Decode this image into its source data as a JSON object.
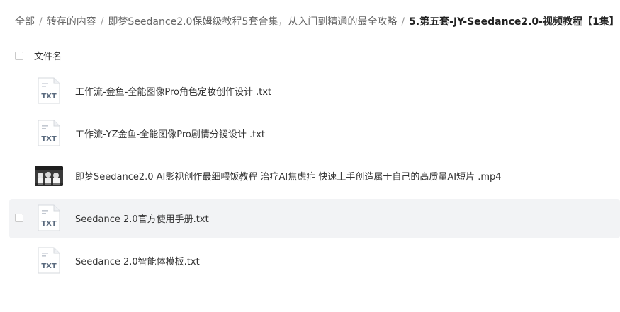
{
  "breadcrumb": {
    "items": [
      {
        "label": "全部"
      },
      {
        "label": "转存的内容"
      },
      {
        "label": "即梦Seedance2.0保姆级教程5套合集，从入门到精通的最全攻略"
      },
      {
        "label": "5.第五套-JY-Seedance2.0-视频教程【1集】"
      }
    ],
    "separator": "/"
  },
  "file_list": {
    "header_label": "文件名",
    "files": [
      {
        "name": "工作流-金鱼-全能图像Pro角色定妆创作设计 .txt",
        "type_badge": "TXT",
        "icon": "txt-file-icon"
      },
      {
        "name": "工作流-YZ金鱼-全能图像Pro剧情分镜设计 .txt",
        "type_badge": "TXT",
        "icon": "txt-file-icon"
      },
      {
        "name": "即梦Seedance2.0 AI影视创作最细喂饭教程 治疗AI焦虑症 快速上手创造属于自己的高质量AI短片 .mp4",
        "type_badge": "",
        "icon": "video-thumbnail"
      },
      {
        "name": "Seedance 2.0官方使用手册.txt",
        "type_badge": "TXT",
        "icon": "txt-file-icon",
        "hovered": true
      },
      {
        "name": "Seedance 2.0智能体模板.txt",
        "type_badge": "TXT",
        "icon": "txt-file-icon"
      }
    ]
  },
  "colors": {
    "hover_row_bg": "#f2f3f5",
    "icon_badge": "#5a6a7e",
    "text_primary": "#333333",
    "text_secondary": "#666666"
  }
}
